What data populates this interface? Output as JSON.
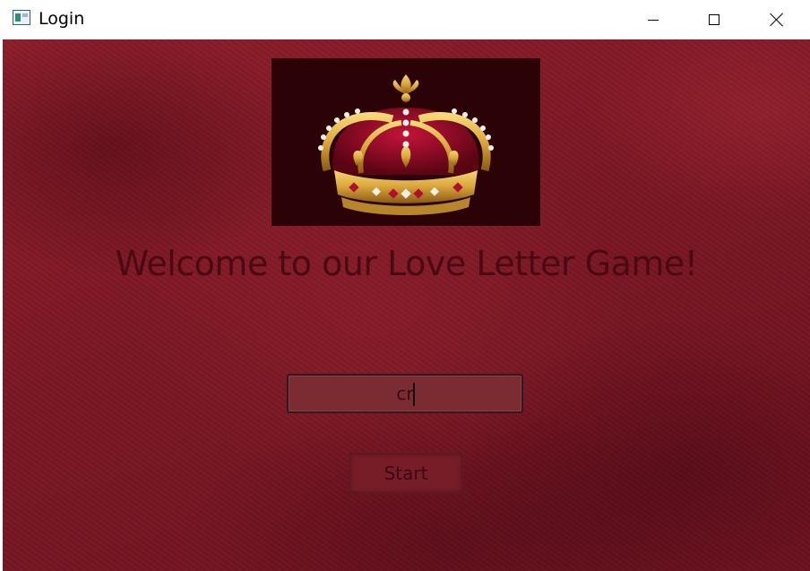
{
  "window": {
    "title": "Login",
    "app_icon": "app-window-icon",
    "controls": [
      "minimize-icon",
      "maximize-icon",
      "close-icon"
    ]
  },
  "main": {
    "logo_icon": "crown-icon",
    "welcome_text": "Welcome to our Love Letter Game!",
    "name_input": {
      "value": "cr",
      "placeholder": ""
    },
    "start_label": "Start"
  },
  "colors": {
    "background": "#7a1623",
    "logo_bg": "#2b0306",
    "welcome_text": "#4a0a12",
    "input_bg": "#7b2c33",
    "button_bg": "#771d28",
    "gold": "#d9a53a"
  }
}
